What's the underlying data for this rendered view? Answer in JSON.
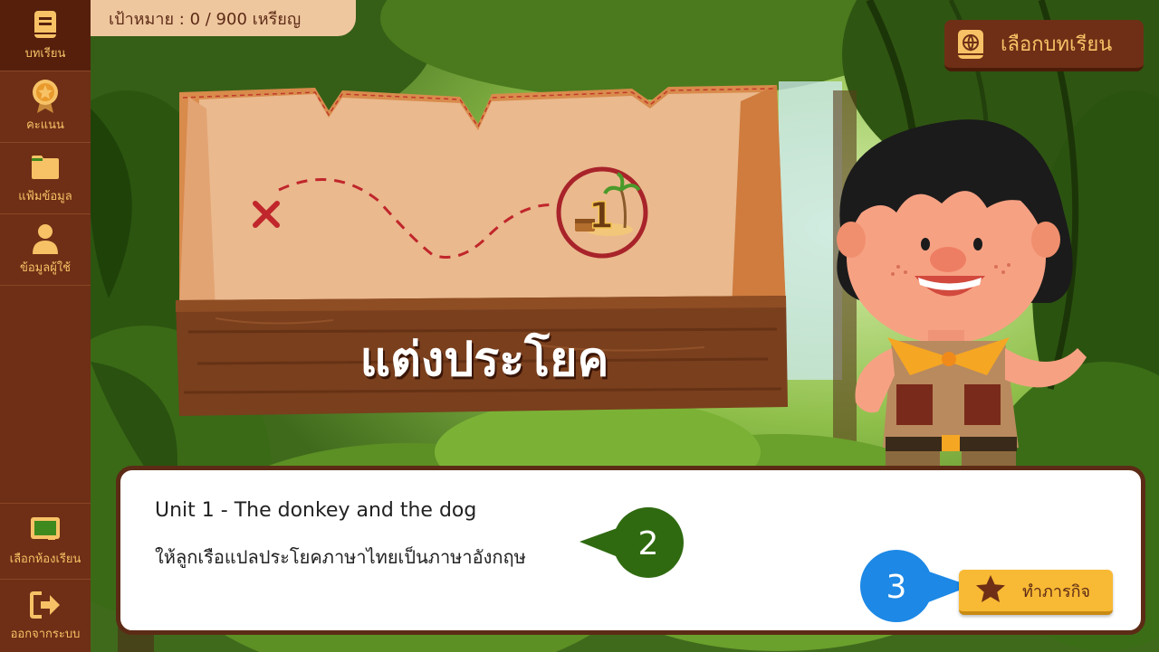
{
  "sidebar": {
    "items": [
      {
        "label": "บทเรียน",
        "icon": "book-icon"
      },
      {
        "label": "คะแนน",
        "icon": "medal-icon"
      },
      {
        "label": "แฟ้มข้อมูล",
        "icon": "folder-icon"
      },
      {
        "label": "ข้อมูลผู้ใช้",
        "icon": "user-icon"
      }
    ],
    "bottom": [
      {
        "label": "เลือกห้องเรียน",
        "icon": "classroom-board-icon"
      },
      {
        "label": "ออกจากระบบ",
        "icon": "logout-icon"
      }
    ]
  },
  "goal": {
    "text": "เป้าหมาย : 0 / 900 เหรียญ"
  },
  "lesson_button": {
    "label": "เลือกบทเรียน",
    "icon": "globe-book-icon"
  },
  "sign": {
    "title": "แต่งประโยค",
    "stage_number": "1"
  },
  "dialog": {
    "unit": "Unit 1 - The donkey and the dog",
    "instruction": "ให้ลูกเรือแปลประโยคภาษาไทยเป็นภาษาอังกฤษ"
  },
  "callouts": {
    "step2": "2",
    "step3": "3"
  },
  "task_button": {
    "label": "ทำภารกิจ",
    "icon": "star-icon"
  },
  "colors": {
    "sidebar": "#6e2f16",
    "accent": "#f7c266",
    "callout_green": "#2f6a10",
    "callout_blue": "#1d88e5",
    "task_button": "#f8b934"
  }
}
